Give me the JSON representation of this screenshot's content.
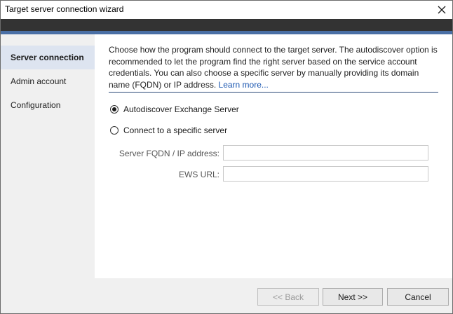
{
  "window": {
    "title": "Target server connection wizard",
    "close_icon": "close-icon"
  },
  "colors": {
    "banner": "#333333",
    "banner_stripe": "#4a6fa5",
    "active_nav": "#dde4f0",
    "link": "#1a56b0",
    "separator": "#2b4a78"
  },
  "sidebar": {
    "items": [
      {
        "label": "Server connection",
        "active": true
      },
      {
        "label": "Admin account",
        "active": false
      },
      {
        "label": "Configuration",
        "active": false
      }
    ]
  },
  "main": {
    "description": "Choose how the program should connect to the target server. The autodiscover option is recommended to let the program find the right server based on the service account credentials. You  can also choose a specific server by manually providing its domain name (FQDN) or IP address.",
    "learn_more": "Learn more...",
    "options": [
      {
        "label": "Autodiscover Exchange Server",
        "selected": true
      },
      {
        "label": "Connect to a specific server",
        "selected": false
      }
    ],
    "fields": {
      "fqdn_label": "Server FQDN / IP address:",
      "fqdn_value": "",
      "ews_label": "EWS URL:",
      "ews_value": ""
    }
  },
  "footer": {
    "back_label": "<< Back",
    "next_label": "Next >>",
    "cancel_label": "Cancel"
  }
}
